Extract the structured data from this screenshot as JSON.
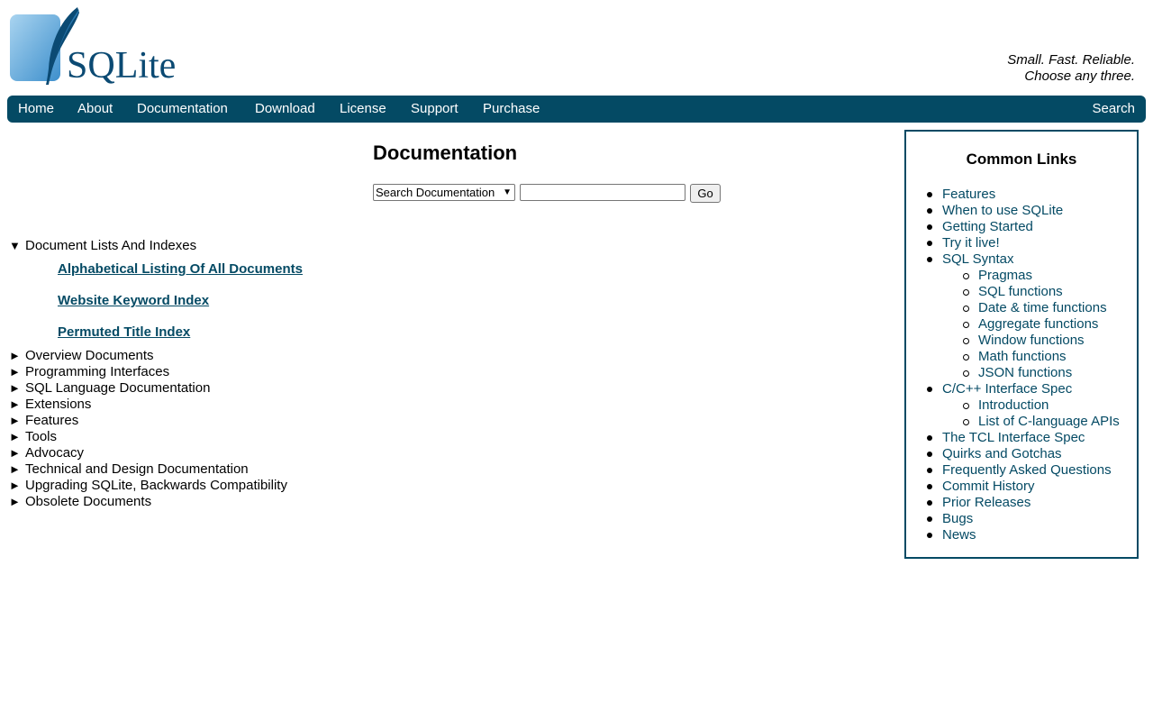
{
  "header": {
    "logo_alt": "SQLite",
    "tagline_line1": "Small. Fast. Reliable.",
    "tagline_line2": "Choose any three."
  },
  "menu": {
    "items": [
      "Home",
      "About",
      "Documentation",
      "Download",
      "License",
      "Support",
      "Purchase"
    ],
    "search_label": "Search"
  },
  "main": {
    "title": "Documentation",
    "search_select_value": "Search Documentation",
    "go_label": "Go",
    "expanded_section": "Document Lists And Indexes",
    "expanded_links": [
      "Alphabetical Listing Of All Documents",
      "Website Keyword Index",
      "Permuted Title Index"
    ],
    "collapsed_sections": [
      "Overview Documents",
      "Programming Interfaces",
      "SQL Language Documentation",
      "Extensions",
      "Features",
      "Tools",
      "Advocacy",
      "Technical and Design Documentation",
      "Upgrading SQLite, Backwards Compatibility",
      "Obsolete Documents"
    ],
    "expanded_marker": "▼",
    "collapsed_marker": "►"
  },
  "common_links": {
    "title": "Common Links",
    "items": [
      {
        "label": "Features",
        "level": 0
      },
      {
        "label": "When to use SQLite",
        "level": 0
      },
      {
        "label": "Getting Started",
        "level": 0
      },
      {
        "label": "Try it live!",
        "level": 0
      },
      {
        "label": "SQL Syntax",
        "level": 0
      },
      {
        "label": "Pragmas",
        "level": 1
      },
      {
        "label": "SQL functions",
        "level": 1
      },
      {
        "label": "Date & time functions",
        "level": 1
      },
      {
        "label": "Aggregate functions",
        "level": 1
      },
      {
        "label": "Window functions",
        "level": 1
      },
      {
        "label": "Math functions",
        "level": 1
      },
      {
        "label": "JSON functions",
        "level": 1
      },
      {
        "label": "C/C++ Interface Spec",
        "level": 0
      },
      {
        "label": "Introduction",
        "level": 1
      },
      {
        "label": "List of C-language APIs",
        "level": 1
      },
      {
        "label": "The TCL Interface Spec",
        "level": 0
      },
      {
        "label": "Quirks and Gotchas",
        "level": 0
      },
      {
        "label": "Frequently Asked Questions",
        "level": 0
      },
      {
        "label": "Commit History",
        "level": 0
      },
      {
        "label": "Prior Releases",
        "level": 0
      },
      {
        "label": "Bugs",
        "level": 0
      },
      {
        "label": "News",
        "level": 0
      }
    ]
  },
  "colors": {
    "brand": "#044a64",
    "logo_light": "#97c8e8",
    "logo_dark": "#0b4a73"
  }
}
